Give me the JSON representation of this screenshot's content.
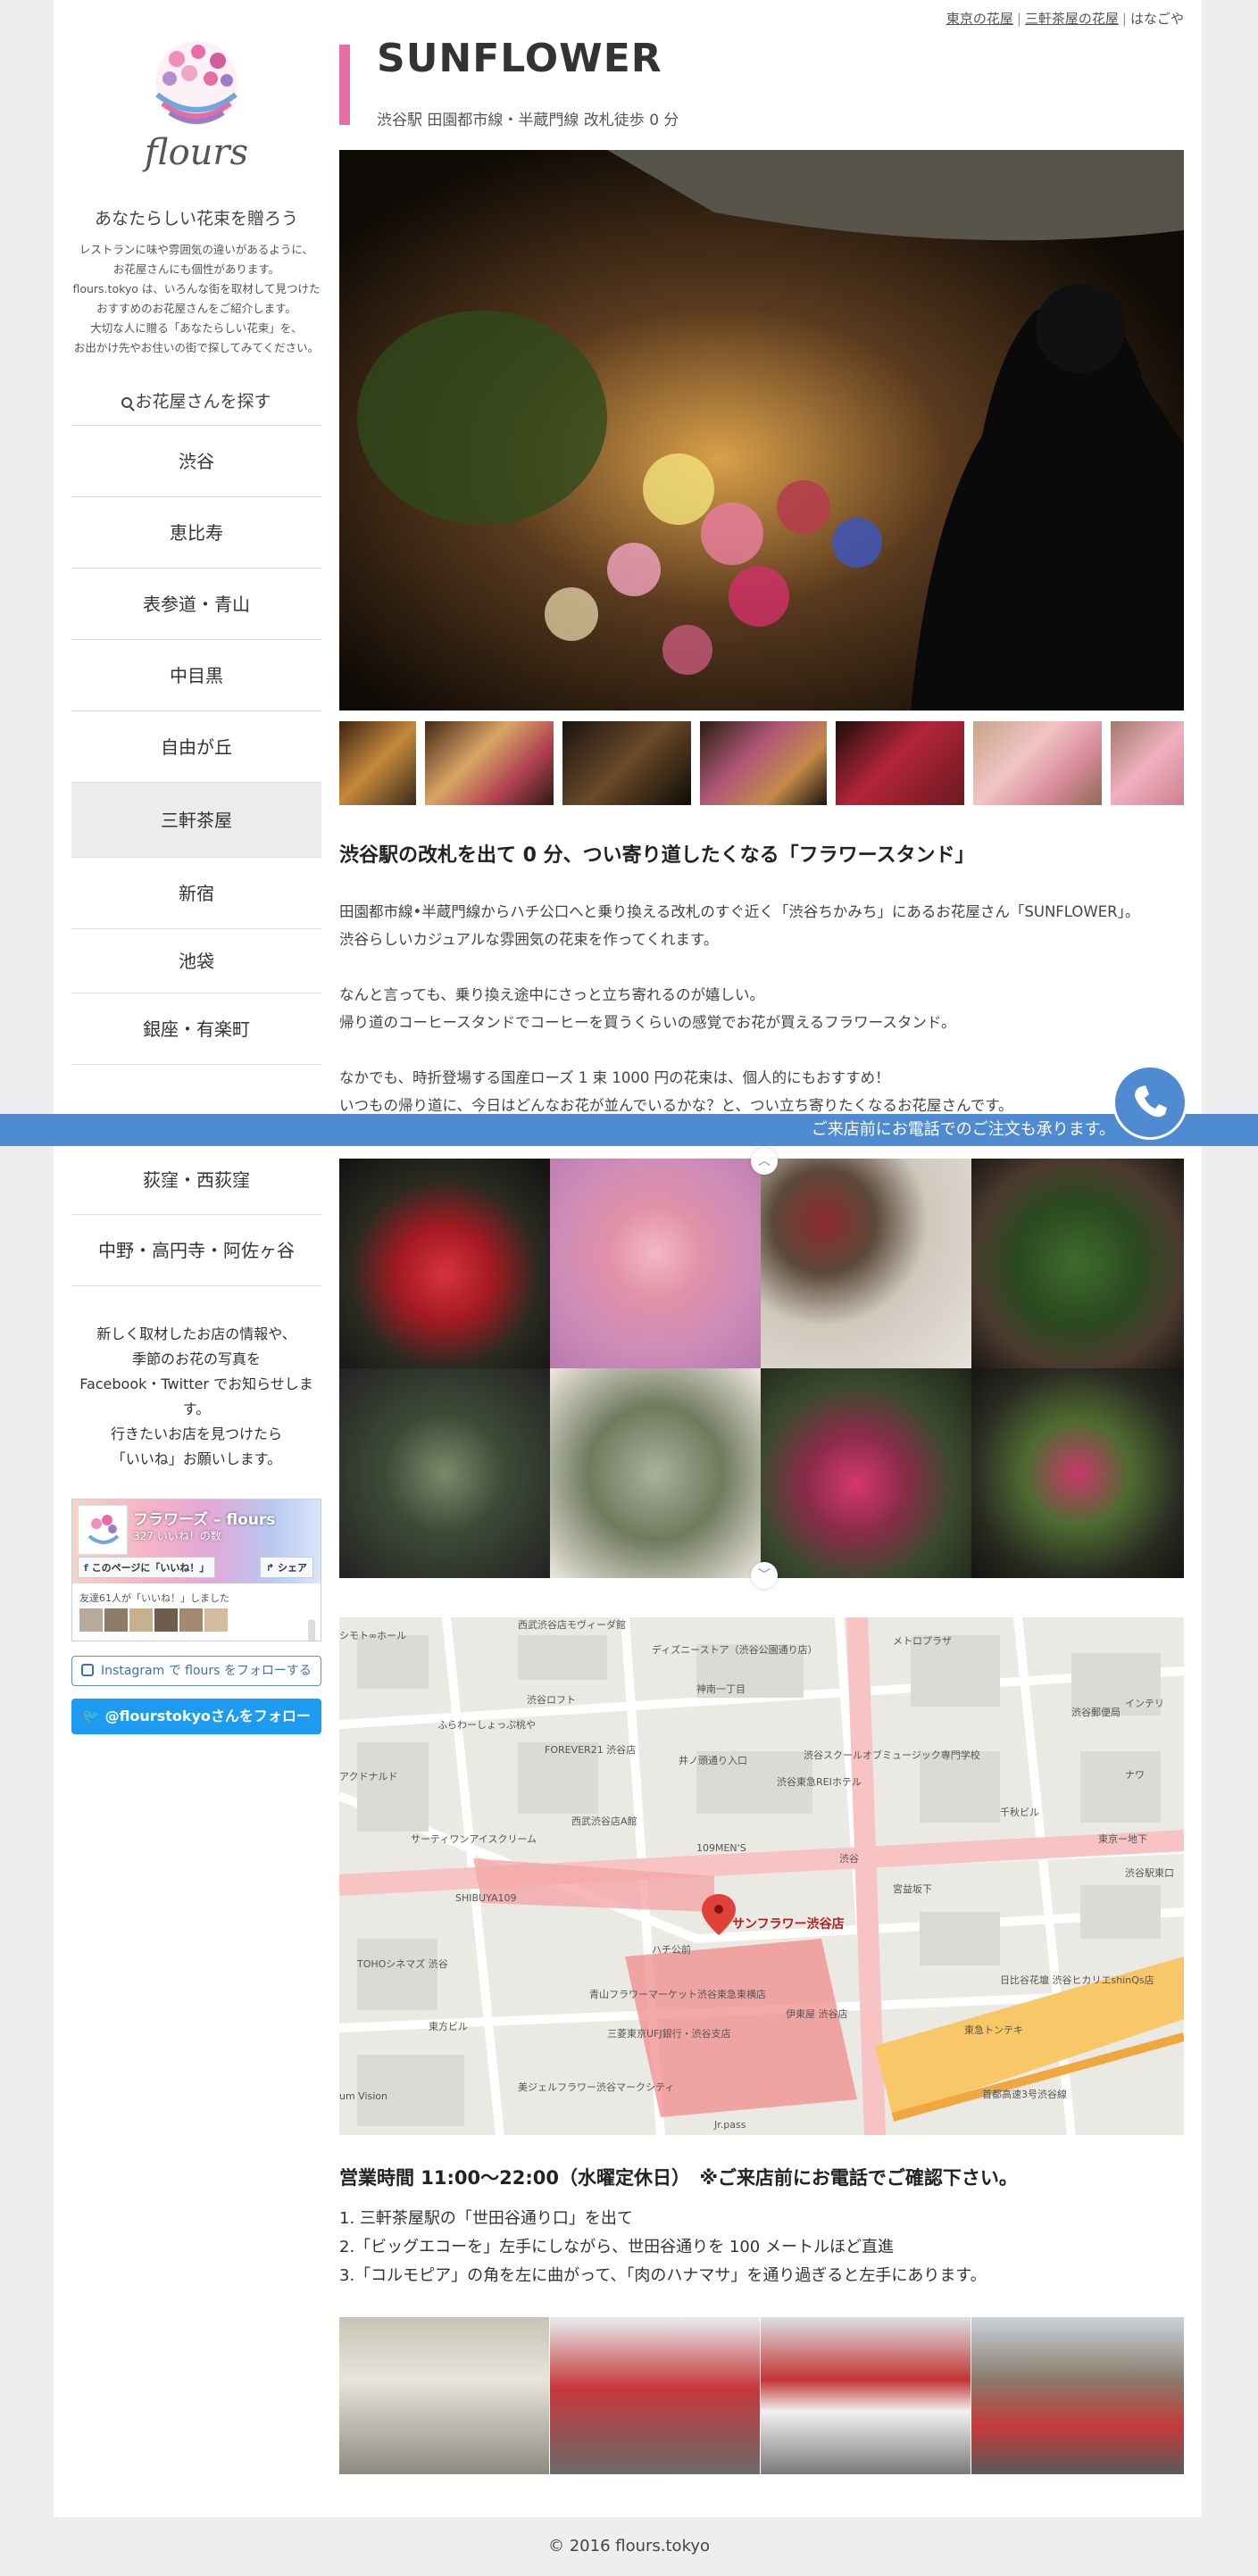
{
  "top_links": {
    "link1": "東京の花屋",
    "link2": "三軒茶屋の花屋",
    "current": "はなごや"
  },
  "sidebar": {
    "logo_text": "flours",
    "tagline": "あなたらしい花束を贈ろう",
    "intro_lines": [
      "レストランに味や雰囲気の違いがあるように、",
      "お花屋さんにも個性があります。",
      "flours.tokyo は、いろんな街を取材して見つけた",
      "おすすめのお花屋さんをご紹介します。",
      "大切な人に贈る「あなたらしい花束」を、",
      "お出かけ先やお住いの街で探してみてください。"
    ],
    "search_heading": "お花屋さんを探す",
    "nav_items": [
      "渋谷",
      "恵比寿",
      "表参道・青山",
      "中目黒",
      "自由が丘",
      "三軒茶屋",
      "新宿",
      "池袋",
      "銀座・有楽町",
      "",
      "荻窪・西荻窪",
      "中野・高円寺・阿佐ヶ谷"
    ],
    "follow_lines": [
      "新しく取材したお店の情報や、",
      "季節のお花の写真を",
      "Facebook・Twitter でお知らせします。",
      "行きたいお店を見つけたら",
      "「いいね」お願いします。"
    ],
    "facebook": {
      "name": "フラワーズ – flours",
      "likes": "327 いいね！の数",
      "like_button": "このページに「いいね！」",
      "share_button": "シェア",
      "friends": "友達61人が「いいね！」しました"
    },
    "instagram_label": "Instagram で flours をフォローする",
    "twitter_label": "@flourstokyoさんをフォロー"
  },
  "shop": {
    "title": "SUNFLOWER",
    "subtitle": "渋谷駅 田園都市線・半蔵門線 改札徒歩 0 分",
    "lead": "渋谷駅の改札を出て 0 分、つい寄り道したくなる「フラワースタンド」",
    "paragraphs": [
      [
        "田園都市線•半蔵門線からハチ公口へと乗り換える改札のすぐ近く「渋谷ちかみち」にあるお花屋さん「SUNFLOWER」。",
        "渋谷らしいカジュアルな雰囲気の花束を作ってくれます。"
      ],
      [
        "なんと言っても、乗り換え途中にさっと立ち寄れるのが嬉しい。",
        "帰り道のコーヒースタンドでコーヒーを買うくらいの感覚でお花が買えるフラワースタンド。"
      ],
      [
        "なかでも、時折登場する国産ローズ 1 束 1000 円の花束は、個人的にもおすすめ！",
        "いつもの帰り道に、今日はどんなお花が並んでいるかな？と、つい立ち寄りたくなるお花屋さんです。"
      ]
    ],
    "hours": "営業時間 11:00〜22:00（水曜定休日）　※ご来店前にお電話でご確認下さい。",
    "directions": [
      "1. 三軒茶屋駅の「世田谷通り口」を出て",
      "2.「ビッグエコーを」左手にしながら、世田谷通りを 100 メートルほど直進",
      "3.「コルモピア」の角を左に曲がって、「肉のハナマサ」を通り過ぎると左手にあります。"
    ]
  },
  "map": {
    "shop_label": "サンフラワー渋谷店",
    "labels": [
      "シモト∞ホール",
      "西武渋谷店モヴィーダ館",
      "ディズニーストア（渋谷公園通り店）",
      "渋谷ロフト",
      "神南一丁目",
      "ふらわーしょっぷ桃や",
      "FOREVER21 渋谷店",
      "井ノ頭通り入口",
      "渋谷スクールオブミュージック専門学校",
      "渋谷東急REIホテル",
      "アクドナルド",
      "西武渋谷店A館",
      "109MEN'S",
      "サーティワンアイスクリーム",
      "渋谷",
      "宮益坂下",
      "東京ー地下",
      "SHIBUYA109",
      "ハチ公前",
      "TOHOシネマズ 渋谷",
      "青山フラワーマーケット渋谷東急東横店",
      "日比谷花壇 渋谷ヒカリエshinQs店",
      "東方ビル",
      "三菱東京UFJ銀行・渋谷支店",
      "東急トンテキ",
      "首都高速3号渋谷線",
      "um Vision",
      "美ジェルフラワー渋谷マークシティ",
      "Jr.pass",
      "千秋ビル",
      "渋谷郵便局",
      "メトロプラザ",
      "インテリ",
      "伊東屋 渋谷店",
      "ナワ",
      "渋谷駅東口"
    ]
  },
  "call_banner": "ご来店前にお電話でのご注文も承ります。",
  "footer": "© 2016 flours.tokyo",
  "colors": {
    "accent_pink": "#e56fa5",
    "banner_blue": "#4f8bd0",
    "twitter_blue": "#1d9bf0"
  }
}
